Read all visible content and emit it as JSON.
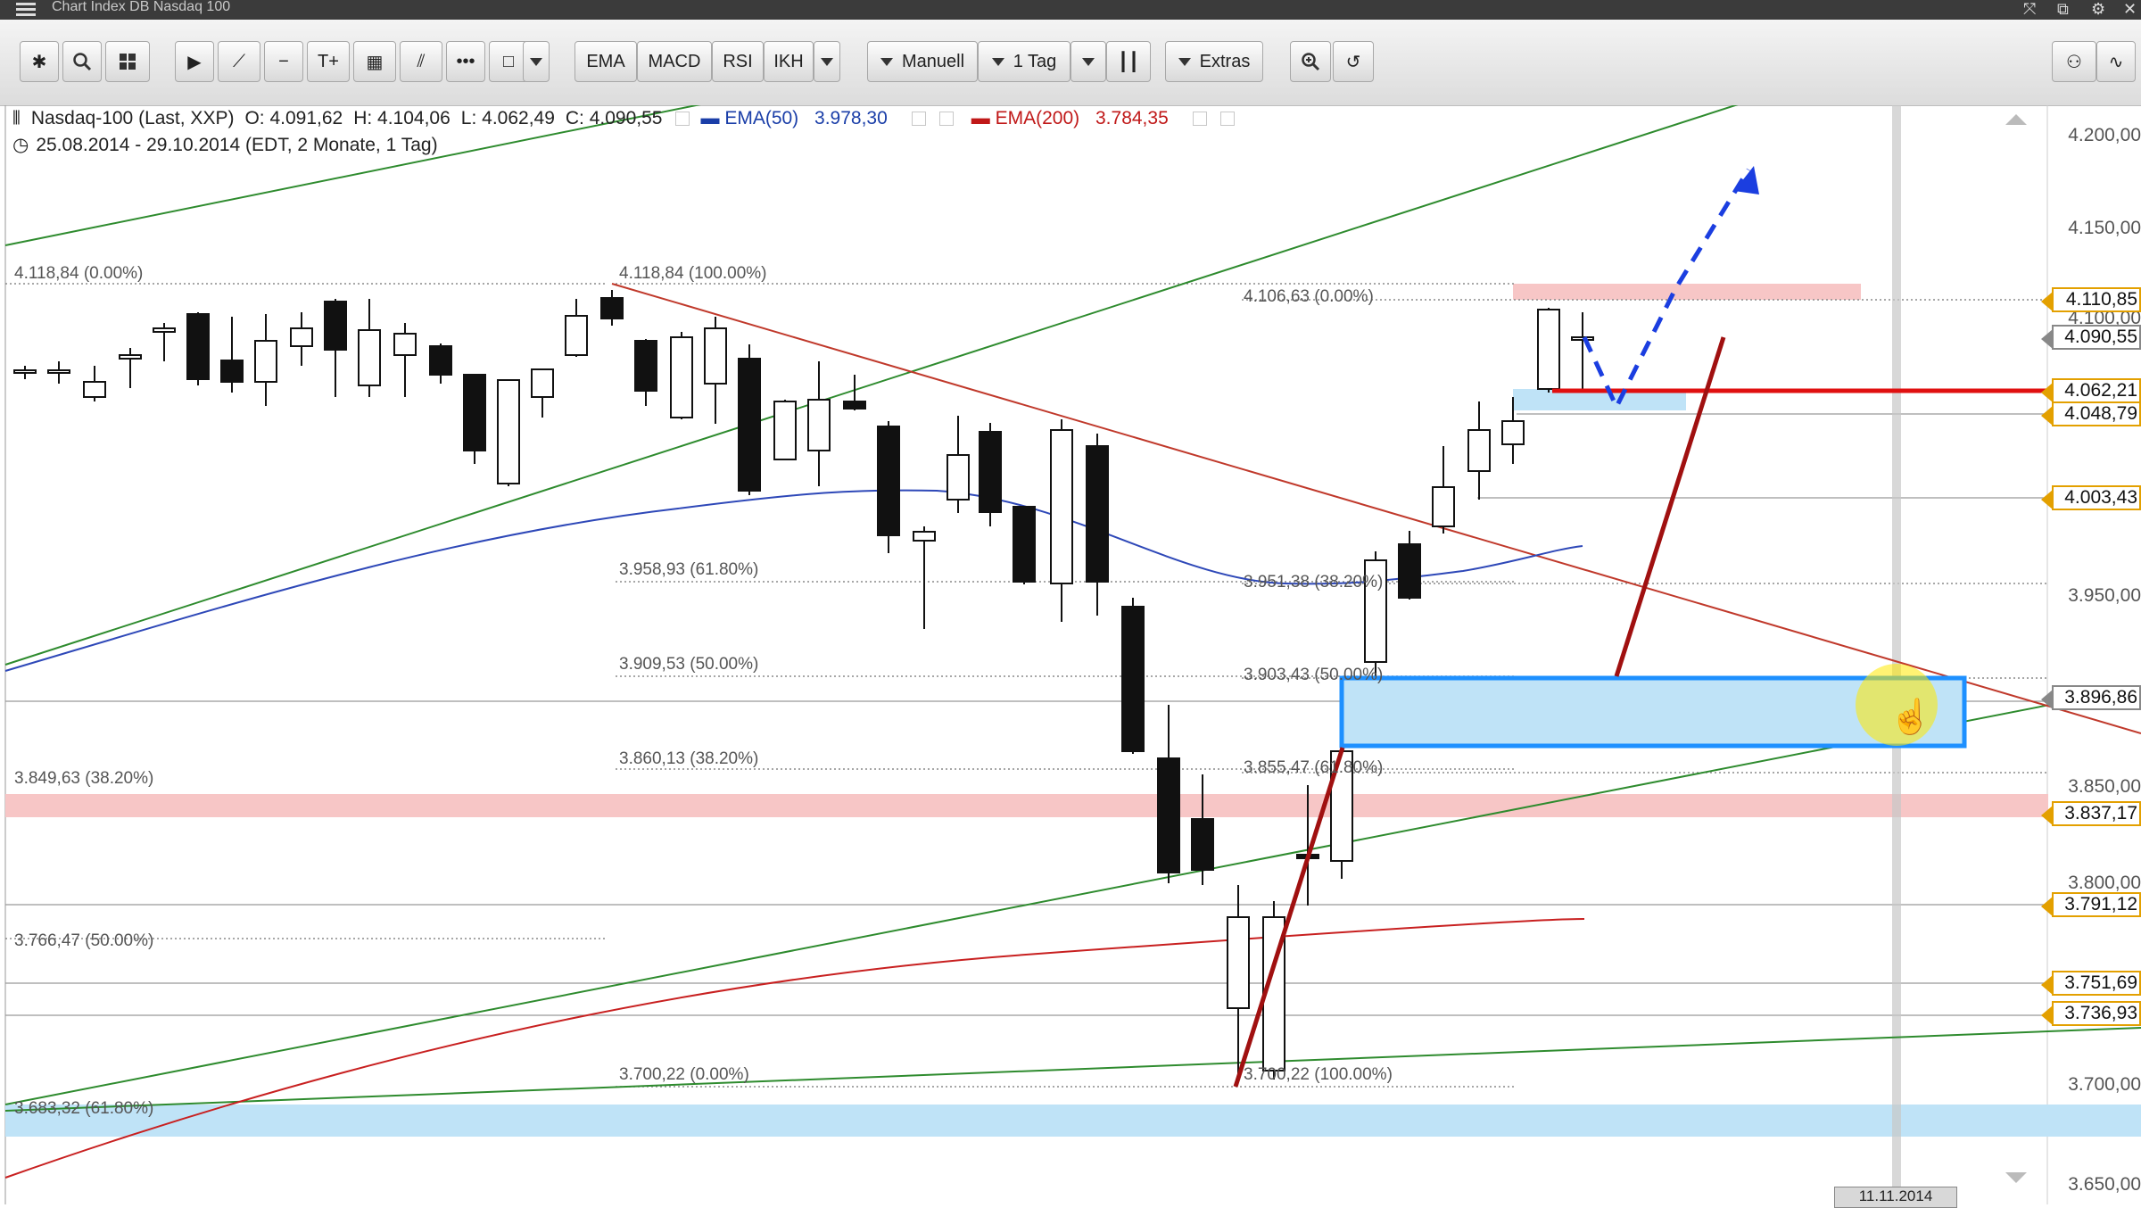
{
  "window": {
    "title": "Chart Index DB Nasdaq 100"
  },
  "toolbar": {
    "ema": "EMA",
    "macd": "MACD",
    "rsi": "RSI",
    "ikh": "IKH",
    "mode": "Manuell",
    "interval": "1 Tag",
    "extras": "Extras"
  },
  "legend": {
    "instrument": "Nasdaq-100 (Last, XXP)",
    "open": "O: 4.091,62",
    "high": "H: 4.104,06",
    "low": "L: 4.062,49",
    "close": "C: 4.090,55",
    "ema50_label": "EMA(50)",
    "ema50_value": "3.978,30",
    "ema200_label": "EMA(200)",
    "ema200_value": "3.784,35",
    "range": "25.08.2014 - 29.10.2014 (EDT, 2 Monate, 1 Tag)"
  },
  "fib_labels": {
    "l_4118": "4.118,84 (0.00%)",
    "l_3849": "3.849,63 (38.20%)",
    "l_3766": "3.766,47 (50.00%)",
    "l_3683": "3.683,32 (61.80%)",
    "m_4118": "4.118,84 (100.00%)",
    "m_3958": "3.958,93 (61.80%)",
    "m_3909": "3.909,53 (50.00%)",
    "m_3860": "3.860,13 (38.20%)",
    "m_3700": "3.700,22 (0.00%)",
    "r_4106": "4.106,63 (0.00%)",
    "r_3951": "3.951,38 (38.20%)",
    "r_3903": "3.903,43 (50.00%)",
    "r_3855": "3.855,47 (61.80%)",
    "r_3700": "3.700,22 (100.00%)"
  },
  "axis": {
    "ticks": [
      "4.200,00",
      "4.150,00",
      "4.100,00",
      "3.950,00",
      "3.850,00",
      "3.800,00",
      "3.700,00",
      "3.650,00"
    ],
    "tags": [
      "4.110,85",
      "4.090,55",
      "4.062,21",
      "4.048,79",
      "4.003,43",
      "3.896,86",
      "3.837,17",
      "3.791,12",
      "3.751,69",
      "3.736,93"
    ],
    "date_marker": "11.11.2014"
  },
  "colors": {
    "ema50": "#2e48b8",
    "ema200": "#c82020",
    "trend_green": "#2e8b2e",
    "zone_blue": "#bfe3f7",
    "zone_red": "#f7c6c6"
  }
}
